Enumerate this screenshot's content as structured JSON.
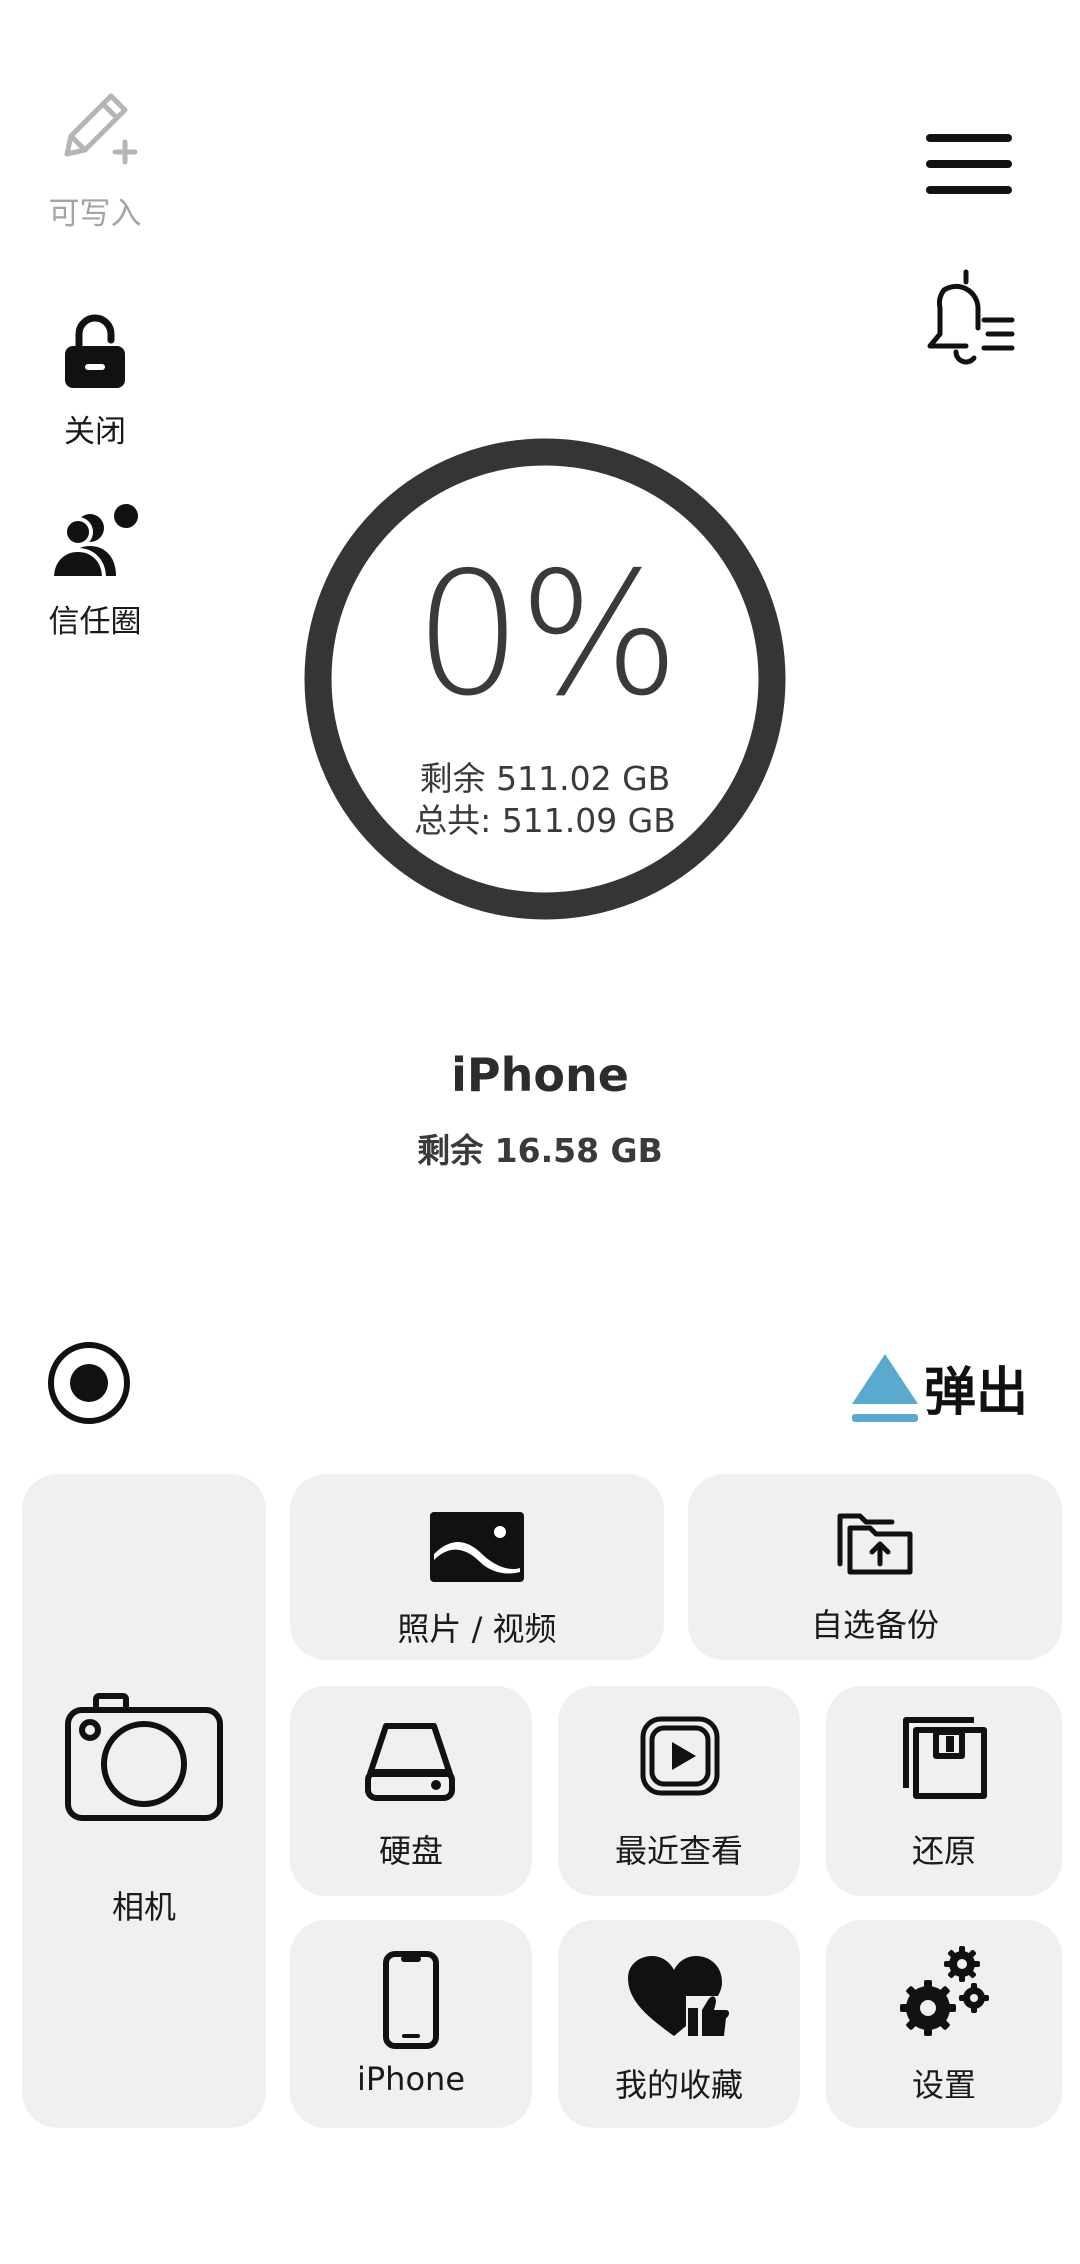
{
  "left_controls": {
    "writable_label": "可写入",
    "lock_label": "关闭",
    "trust_label": "信任圈"
  },
  "storage": {
    "percent": "0%",
    "remaining": "剩余 511.02 GB",
    "total": "总共: 511.09 GB",
    "used_fraction": 0
  },
  "device": {
    "name": "iPhone",
    "free": "剩余 16.58 GB"
  },
  "eject_label": "弹出",
  "tiles": {
    "camera": "相机",
    "photos": "照片 / 视频",
    "backup": "自选备份",
    "disk": "硬盘",
    "recent": "最近查看",
    "restore": "还原",
    "iphone": "iPhone",
    "favorites": "我的收藏",
    "settings": "设置"
  },
  "colors": {
    "ring": "#353533",
    "eject_accent": "#5aa9cf",
    "tile_bg": "#f0f0f0"
  }
}
